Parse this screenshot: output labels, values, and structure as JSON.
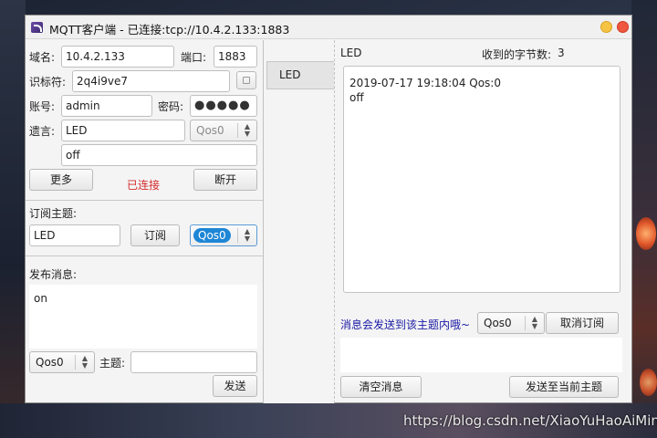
{
  "window": {
    "title": "MQTT客户端 - 已连接:tcp://10.4.2.133:1883"
  },
  "connection": {
    "domain_label": "域名:",
    "domain_value": "10.4.2.133",
    "port_label": "端口:",
    "port_value": "1883",
    "id_label": "识标符:",
    "id_value": "2q4i9ve7",
    "account_label": "账号:",
    "account_value": "admin",
    "password_label": "密码:",
    "password_value": "●●●●●",
    "will_label": "遗言:",
    "will_topic": "LED",
    "will_qos": "Qos0",
    "will_message": "off",
    "more_label": "更多",
    "status_text": "已连接",
    "disconnect_label": "断开",
    "status_color": "#d42a2a"
  },
  "subscribe": {
    "heading": "订阅主题:",
    "topic_value": "LED",
    "subscribe_label": "订阅",
    "qos_value": "Qos0"
  },
  "publish": {
    "heading": "发布消息:",
    "message_value": "on",
    "qos_value": "Qos0",
    "topic_label": "主题:",
    "topic_value": "",
    "send_label": "发送"
  },
  "tabs": [
    {
      "label": "LED"
    }
  ],
  "receive": {
    "topic": "LED",
    "bytes_label": "收到的字节数:",
    "bytes_count": "3",
    "log_line_1": "2019-07-17 19:18:04 Qos:0",
    "log_line_2": "off",
    "hint_text": "消息会发送到该主题内哦~",
    "hint_color": "#1a1aa6",
    "qos_value": "Qos0",
    "unsubscribe_label": "取消订阅",
    "reply_value": "",
    "clear_label": "清空消息",
    "send_current_label": "发送至当前主题"
  },
  "watermark": "https://blog.csdn.net/XiaoYuHaoAiMin"
}
